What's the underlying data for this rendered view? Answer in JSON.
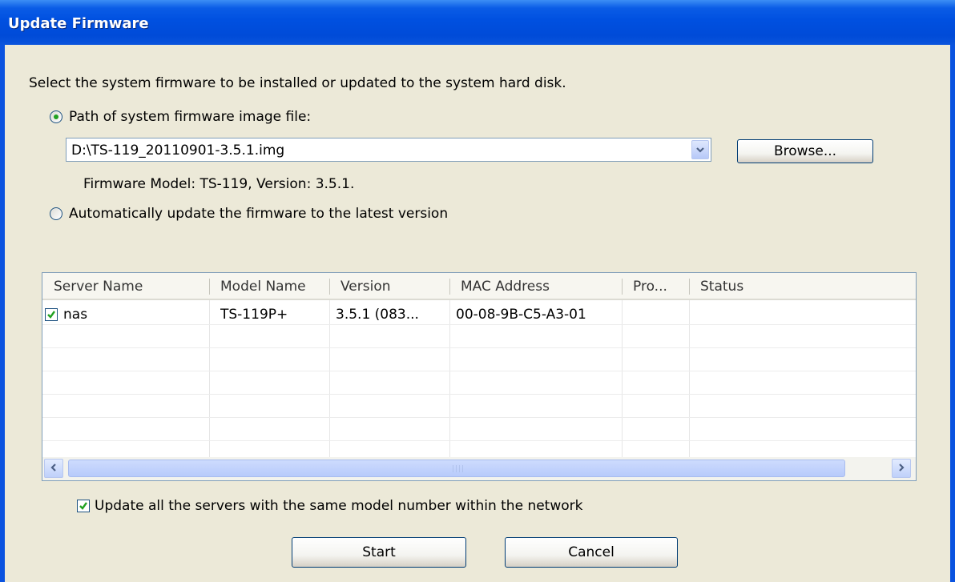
{
  "window": {
    "title": "Update Firmware"
  },
  "instructions": "Select the system firmware to be installed or updated to the system hard disk.",
  "option_path": {
    "label": "Path of system firmware image file:",
    "selected": true
  },
  "path_combo": {
    "value": "D:\\TS-119_20110901-3.5.1.img"
  },
  "browse_label": "Browse...",
  "firmware_info": "Firmware Model: TS-119, Version: 3.5.1.",
  "option_auto": {
    "label": "Automatically update the firmware to the latest version",
    "selected": false
  },
  "table": {
    "columns": [
      "Server Name",
      "Model Name",
      "Version",
      "MAC Address",
      "Pro...",
      "Status"
    ],
    "rows": [
      {
        "checked": true,
        "server_name": "nas",
        "model_name": "TS-119P+",
        "version": "3.5.1 (083...",
        "mac": "00-08-9B-C5-A3-01",
        "pro": "",
        "status": ""
      }
    ]
  },
  "update_all": {
    "label": "Update all the servers with the same model number within the network",
    "checked": true
  },
  "buttons": {
    "start": "Start",
    "cancel": "Cancel"
  },
  "icons": {
    "combo_arrow": "chevron-down-icon",
    "scroll_left": "chevron-left-icon",
    "scroll_right": "chevron-right-icon",
    "check": "check-icon"
  },
  "colors": {
    "titlebar": "#0050e0",
    "window_bg": "#ece9d8",
    "radio_dot": "#21a121",
    "check_mark": "#21a121"
  }
}
